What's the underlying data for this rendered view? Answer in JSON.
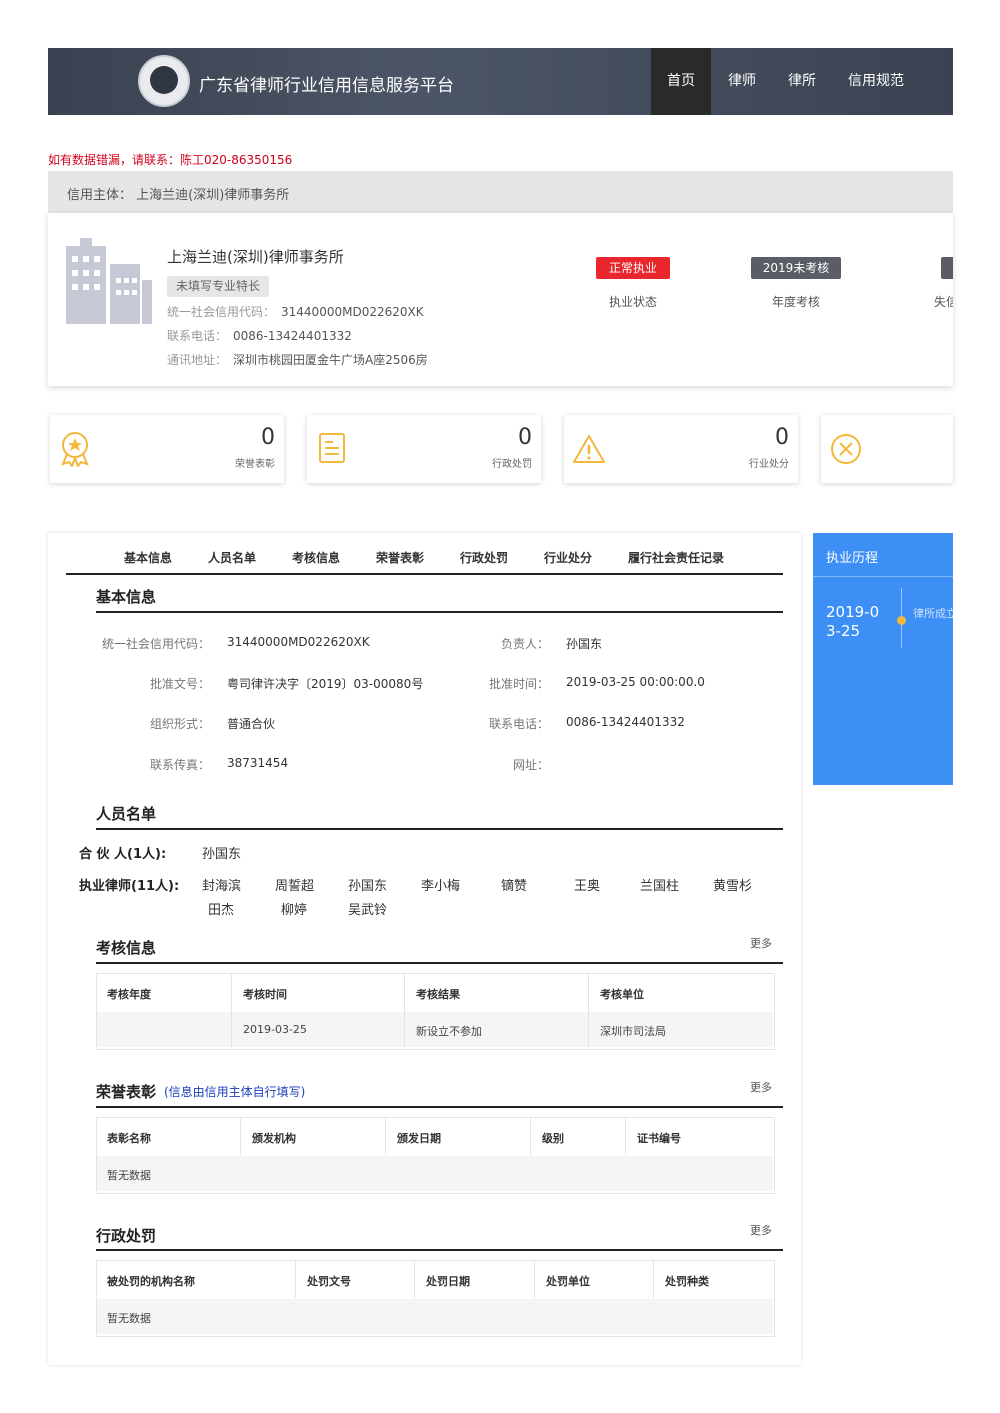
{
  "header": {
    "site_title": "广东省律师行业信用信息服务平台",
    "nav": [
      "首页",
      "律师",
      "律所",
      "信用规范"
    ]
  },
  "notice": "如有数据错漏，请联系：陈工020-86350156",
  "subject": {
    "label": "信用主体：",
    "name": "上海兰迪(深圳)律师事务所"
  },
  "card": {
    "firm_name": "上海兰迪(深圳)律师事务所",
    "specialty_tag": "未填写专业特长",
    "credit_code_label": "统一社会信用代码：",
    "credit_code": "31440000MD022620XK",
    "phone_label": "联系电话：",
    "phone": "0086-13424401332",
    "address_label": "通讯地址：",
    "address": "深圳市桃园田厦金牛广场A座2506房",
    "status_badge": "正常执业",
    "status_label": "执业状态",
    "annual_badge": "2019未考核",
    "annual_label": "年度考核",
    "third_label": "失信",
    "colors": {
      "status": "#e8262b",
      "annual": "#5a5d66"
    }
  },
  "stats": [
    {
      "icon": "award-icon",
      "value": "0",
      "label": "荣誉表彰"
    },
    {
      "icon": "document-icon",
      "value": "0",
      "label": "行政处罚"
    },
    {
      "icon": "warning-icon",
      "value": "0",
      "label": "行业处分"
    },
    {
      "icon": "close-circle-icon"
    }
  ],
  "tabs": [
    "基本信息",
    "人员名单",
    "考核信息",
    "荣誉表彰",
    "行政处罚",
    "行业处分",
    "履行社会责任记录"
  ],
  "basic_info": {
    "title": "基本信息",
    "left": [
      {
        "label": "统一社会信用代码：",
        "value": "31440000MD022620XK"
      },
      {
        "label": "批准文号：",
        "value": "粤司律许决字〔2019〕03-00080号"
      },
      {
        "label": "组织形式：",
        "value": "普通合伙"
      },
      {
        "label": "联系传真：",
        "value": "38731454"
      }
    ],
    "right": [
      {
        "label": "负责人：",
        "value": "孙国东"
      },
      {
        "label": "批准时间：",
        "value": "2019-03-25 00:00:00.0"
      },
      {
        "label": "联系电话：",
        "value": "0086-13424401332"
      },
      {
        "label": "网址：",
        "value": ""
      }
    ]
  },
  "personnel": {
    "title": "人员名单",
    "partners_label": "合 伙 人(1人):",
    "partners": [
      "孙国东"
    ],
    "lawyers_label": "执业律师(11人):",
    "lawyers": [
      "封海滨",
      "周誓超",
      "孙国东",
      "李小梅",
      "镝赞",
      "王奥",
      "兰国柱",
      "黄雪杉",
      "田杰",
      "柳婷",
      "吴武铃"
    ]
  },
  "assessment": {
    "title": "考核信息",
    "more": "更多",
    "headers": [
      "考核年度",
      "考核时间",
      "考核结果",
      "考核单位"
    ],
    "row": [
      "",
      "2019-03-25",
      "新设立不参加",
      "深圳市司法局"
    ]
  },
  "honors": {
    "title": "荣誉表彰",
    "note": "(信息由信用主体自行填写)",
    "more": "更多",
    "headers": [
      "表彰名称",
      "颁发机构",
      "颁发日期",
      "级别",
      "证书编号"
    ],
    "empty": "暂无数据"
  },
  "penalties": {
    "title": "行政处罚",
    "more": "更多",
    "headers": [
      "被处罚的机构名称",
      "处罚文号",
      "处罚日期",
      "处罚单位",
      "处罚种类"
    ],
    "empty": "暂无数据"
  },
  "history": {
    "title": "执业历程",
    "date": "2019-03-25",
    "event": "律所成立"
  }
}
